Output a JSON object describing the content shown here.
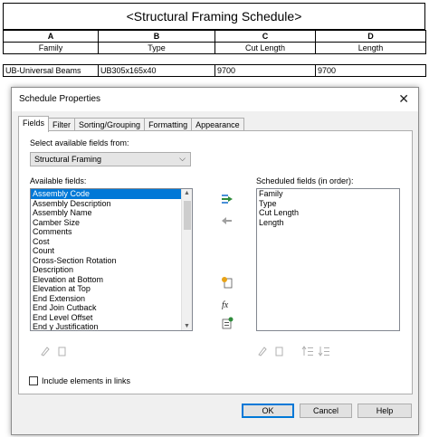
{
  "schedule": {
    "title": "<Structural Framing Schedule>",
    "letters": [
      "A",
      "B",
      "C",
      "D"
    ],
    "headers": [
      "Family",
      "Type",
      "Cut Length",
      "Length"
    ],
    "row": [
      "UB-Universal Beams",
      "UB305x165x40",
      "9700",
      "9700"
    ]
  },
  "dialog": {
    "title": "Schedule Properties",
    "close_glyph": "✕",
    "tabs": [
      "Fields",
      "Filter",
      "Sorting/Grouping",
      "Formatting",
      "Appearance"
    ],
    "active_tab": "Fields",
    "select_label": "Select available fields from:",
    "source_value": "Structural Framing",
    "available_label": "Available fields:",
    "available_fields": [
      "Assembly Code",
      "Assembly Description",
      "Assembly Name",
      "Camber Size",
      "Comments",
      "Cost",
      "Count",
      "Cross-Section Rotation",
      "Description",
      "Elevation at Bottom",
      "Elevation at Top",
      "End Extension",
      "End Join Cutback",
      "End Level Offset",
      "End y Justification"
    ],
    "selected_field": "Assembly Code",
    "scheduled_label": "Scheduled fields (in order):",
    "scheduled_fields": [
      "Family",
      "Type",
      "Cut Length",
      "Length"
    ],
    "include_links_label": "Include elements in links",
    "buttons": {
      "ok": "OK",
      "cancel": "Cancel",
      "help": "Help"
    }
  },
  "colors": {
    "selection": "#0078d7",
    "dialog_bg": "#f0f0f0"
  }
}
